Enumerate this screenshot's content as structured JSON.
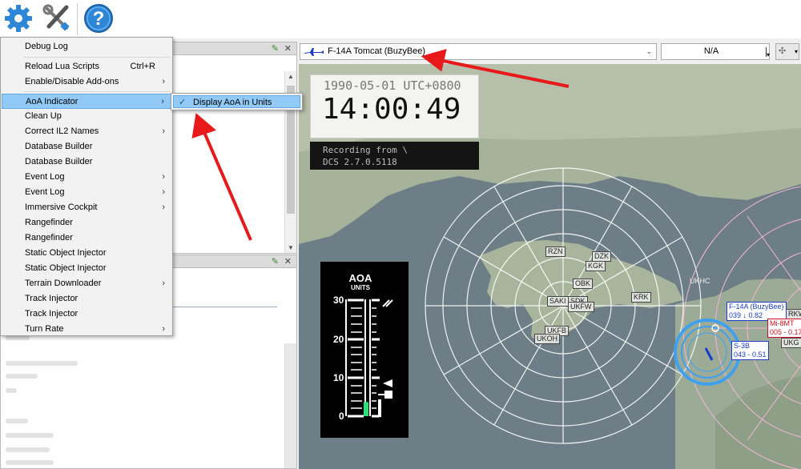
{
  "menu": {
    "items": [
      {
        "label": "Debug Log",
        "shortcut": "",
        "submenu": false
      },
      {
        "label": "Reload Lua Scripts",
        "shortcut": "Ctrl+R",
        "submenu": false
      },
      {
        "label": "Enable/Disable Add-ons",
        "shortcut": "",
        "submenu": true
      },
      {
        "label": "AoA Indicator",
        "shortcut": "",
        "submenu": true
      },
      {
        "label": "Clean Up",
        "shortcut": "",
        "submenu": false
      },
      {
        "label": "Correct IL2 Names",
        "shortcut": "",
        "submenu": true
      },
      {
        "label": "Database Builder",
        "shortcut": "",
        "submenu": false
      },
      {
        "label": "Database Builder",
        "shortcut": "",
        "submenu": false
      },
      {
        "label": "Event Log",
        "shortcut": "",
        "submenu": true
      },
      {
        "label": "Event Log",
        "shortcut": "",
        "submenu": true
      },
      {
        "label": "Immersive Cockpit",
        "shortcut": "",
        "submenu": true
      },
      {
        "label": "Rangefinder",
        "shortcut": "",
        "submenu": false
      },
      {
        "label": "Rangefinder",
        "shortcut": "",
        "submenu": false
      },
      {
        "label": "Static Object Injector",
        "shortcut": "",
        "submenu": false
      },
      {
        "label": "Static Object Injector",
        "shortcut": "",
        "submenu": false
      },
      {
        "label": "Terrain Downloader",
        "shortcut": "",
        "submenu": true
      },
      {
        "label": "Track Injector",
        "shortcut": "",
        "submenu": false
      },
      {
        "label": "Track Injector",
        "shortcut": "",
        "submenu": false
      },
      {
        "label": "Turn Rate",
        "shortcut": "",
        "submenu": true
      }
    ],
    "submenu_item": "Display AoA in Units"
  },
  "view": {
    "object_combo": "F-14A Tomcat (BuzyBee)",
    "target_combo": "N/A"
  },
  "clock": {
    "date": "1990-05-01",
    "timezone": "UTC+0800",
    "time": "14:00:49"
  },
  "recording": {
    "line1": "Recording from \\",
    "line2": "DCS 2.7.0.5118"
  },
  "aoa_gauge": {
    "title": "AOA",
    "subtitle": "UNITS",
    "ticks": [
      "30",
      "20",
      "10",
      "0"
    ],
    "value_units": 2
  },
  "map": {
    "airfields": [
      "RZN",
      "DZK",
      "KGK",
      "OBK",
      "SAKI",
      "SDK",
      "UKFW",
      "KRK",
      "UKFB",
      "UKOH",
      "UKHC",
      "RKW",
      "UKG"
    ],
    "units": [
      {
        "name": "F-14A (BuzyBee)",
        "info": "039 ↓ 0.82",
        "color": "#1a3ccc"
      },
      {
        "name": "Mi-8MT",
        "info": "005 - 0.17",
        "color": "#d01020"
      },
      {
        "name": "S-3B",
        "info": "043 - 0.51",
        "color": "#1a3ccc"
      }
    ]
  },
  "colors": {
    "highlight": "#91c9f7",
    "friendly": "#1a3ccc",
    "hostile": "#d01020",
    "arrow": "#e8191a"
  }
}
